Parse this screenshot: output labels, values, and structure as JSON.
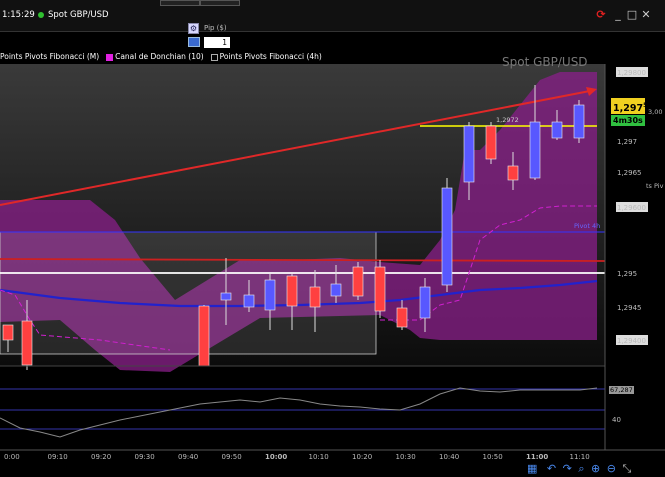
{
  "topbar": {
    "clock": "1:15:29",
    "instrument": "Spot GBP/USD",
    "pip_label": "Pip ($)",
    "pip_value": "1"
  },
  "indicators": [
    {
      "label": "Points Pivots Fibonacci (M)",
      "color": "#000000"
    },
    {
      "label": "Canal de Donchian (10)",
      "color": "#e020e0"
    },
    {
      "label": "Points Pivots Fibonacci (4h)",
      "color": "#000000"
    }
  ],
  "watermark": "Spot GBP/USD",
  "price_axis": {
    "labels": [
      "1,29800",
      "1,297",
      "1,2965",
      "1,29600",
      "1,295",
      "1,2945",
      "1,29400"
    ],
    "current_price_main": "1,297",
    "current_price_sup": "5",
    "countdown": "4m30s",
    "pivot_label": "Pivot 4h",
    "inline_label": "1,2972",
    "right_edge_labels": [
      "3,00",
      "ts Piv"
    ]
  },
  "oscillator_axis": {
    "labels": [
      "67,287",
      "40"
    ]
  },
  "time_axis": {
    "labels": [
      "0:00",
      "09:10",
      "09:20",
      "09:30",
      "09:40",
      "09:50",
      "10:00",
      "10:10",
      "10:20",
      "10:30",
      "10:40",
      "10:50",
      "11:00",
      "11:10"
    ]
  },
  "colors": {
    "bull": "#5858ff",
    "bear": "#ff4040",
    "donchian": "#c020c0",
    "trend": "#e03030",
    "ma_blue": "#3030c0",
    "yellow": "#ffff00"
  },
  "icons": [
    "refresh-icon",
    "minimize-icon",
    "maximize-icon",
    "close-icon",
    "wrench-icon",
    "keyboard-icon",
    "calendar-icon",
    "undo-icon",
    "redo-icon",
    "zoom-icon",
    "zoom-in-icon",
    "zoom-out-icon",
    "drag-icon"
  ]
}
